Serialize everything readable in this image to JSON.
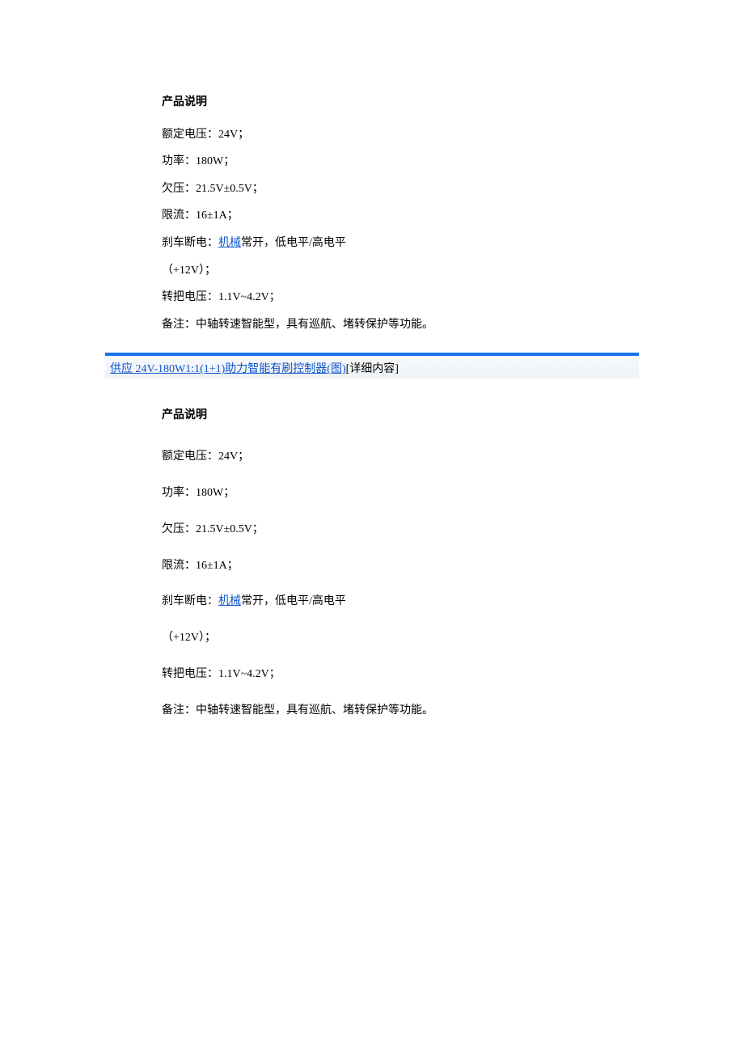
{
  "section1": {
    "heading": "产品说明",
    "lines": {
      "l1": "额定电压：24V；",
      "l2": "功率：180W；",
      "l3": "欠压：21.5V±0.5V；",
      "l4": "限流：16±1A；",
      "l5a": "刹车断电：",
      "l5link": "机械",
      "l5b": "常开，低电平/高电平",
      "l6": "（+12V）；",
      "l7": "转把电压：1.1V~4.2V；",
      "l8": "备注：中轴转速智能型，具有巡航、堵转保护等功能。"
    }
  },
  "titlebar": {
    "link": "供应 24V-180W1:1(1+1)助力智能有刷控制器(图)",
    "suffix": "[详细内容]"
  },
  "section2": {
    "heading": "产品说明",
    "lines": {
      "l1": "额定电压：24V；",
      "l2": "功率：180W；",
      "l3": "欠压：21.5V±0.5V；",
      "l4": "限流：16±1A；",
      "l5a": "刹车断电：",
      "l5link": "机械",
      "l5b": "常开，低电平/高电平",
      "l6": "（+12V）；",
      "l7": "转把电压：1.1V~4.2V；",
      "l8": "备注：中轴转速智能型，具有巡航、堵转保护等功能。"
    }
  }
}
